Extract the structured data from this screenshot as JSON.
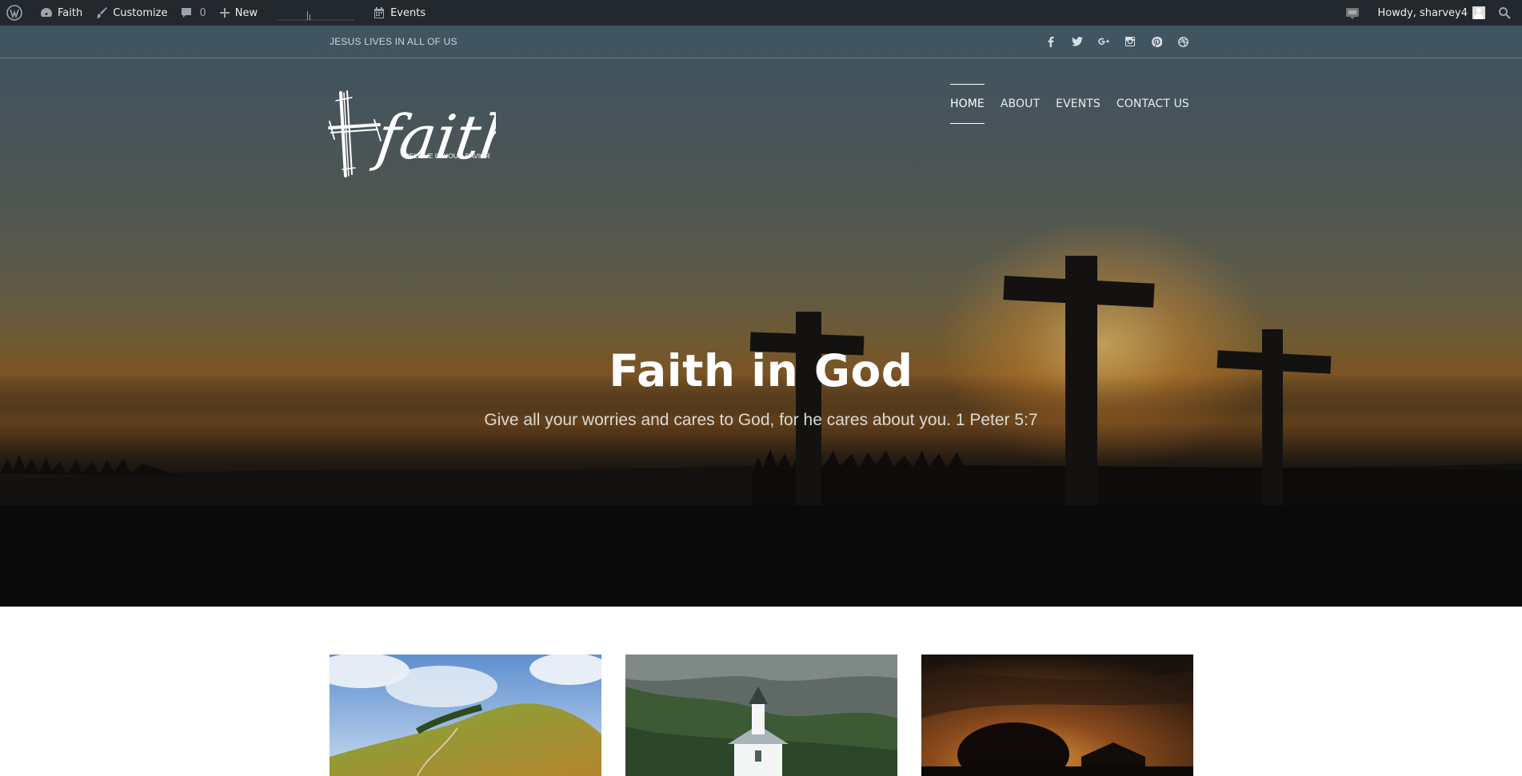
{
  "admin_bar": {
    "site_name": "Faith",
    "customize": "Customize",
    "comments_count": "0",
    "new_label": "New",
    "events_label": "Events",
    "greeting": "Howdy, sharvey4"
  },
  "topbar": {
    "tagline": "JESUS LIVES IN ALL OF US",
    "social": [
      "facebook-icon",
      "twitter-icon",
      "google-plus-icon",
      "instagram-icon",
      "pinterest-icon",
      "dribbble-icon"
    ]
  },
  "logo": {
    "word": "faith",
    "slogan": "BELIEVE IN YOUR SAVIOR"
  },
  "nav": {
    "items": [
      {
        "label": "HOME"
      },
      {
        "label": "ABOUT"
      },
      {
        "label": "EVENTS"
      },
      {
        "label": "CONTACT US"
      }
    ]
  },
  "hero": {
    "title": "Faith in God",
    "subtitle": "Give all your worries and cares to God, for he cares about you. 1 Peter 5:7"
  },
  "colors": {
    "admin_bar": "#23282d",
    "white": "#ffffff"
  }
}
